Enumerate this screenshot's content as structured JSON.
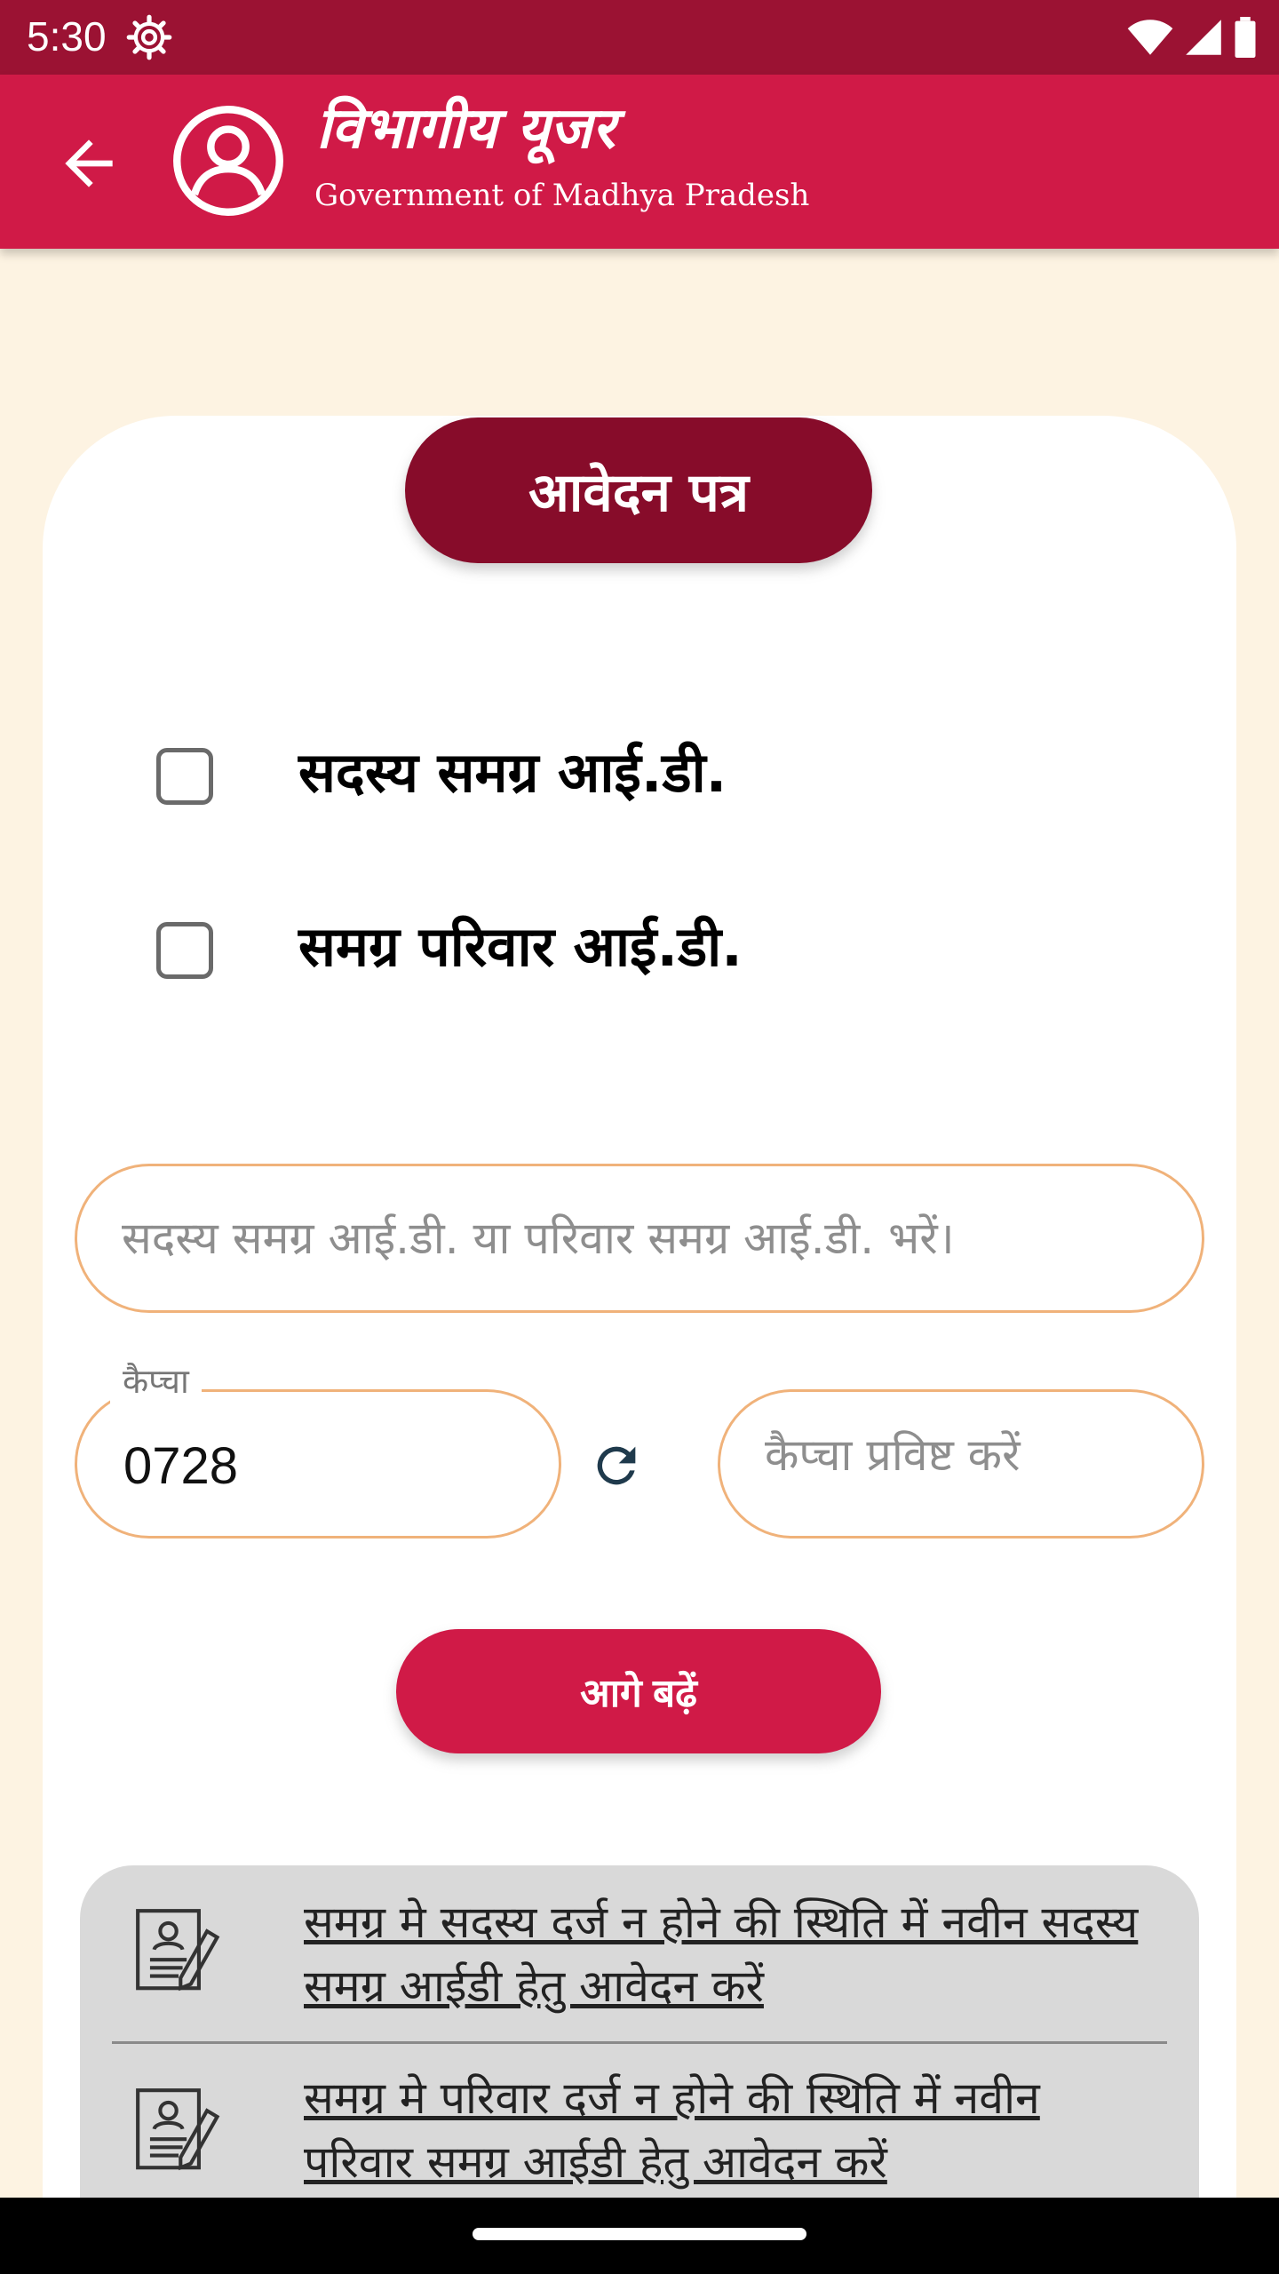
{
  "status_bar": {
    "time": "5:30",
    "icons": [
      "gear-icon",
      "wifi-icon",
      "signal-icon",
      "battery-icon"
    ],
    "background": "#9b1233"
  },
  "app_bar": {
    "title": "विभागीय यूजर",
    "subtitle": "Government of Madhya Pradesh",
    "background": "#d01a47"
  },
  "form": {
    "header": "आवेदन पत्र",
    "options": [
      {
        "label": "सदस्य समग्र आई.डी.",
        "checked": false
      },
      {
        "label": "समग्र परिवार आई.डी.",
        "checked": false
      }
    ],
    "id_input": {
      "placeholder": "सदस्य समग्र आई.डी. या परिवार समग्र आई.डी. भरें।",
      "value": ""
    },
    "captcha": {
      "label": "कैप्चा",
      "value": "0728"
    },
    "captcha_input": {
      "placeholder": "कैप्चा प्रविष्ट करें",
      "value": ""
    },
    "next_button": "आगे बढ़ें"
  },
  "links": [
    {
      "text": "समग्र मे सदस्य दर्ज न होने की स्थिति में नवीन सदस्य समग्र आईडी हेतु आवेदन करें",
      "icon": "application-form-icon"
    },
    {
      "text": "समग्र मे परिवार दर्ज न होने की स्थिति में नवीन परिवार समग्र आईडी हेतु आवेदन करें",
      "icon": "application-form-icon"
    }
  ],
  "colors": {
    "primary": "#d01a47",
    "dark_primary": "#870c2a",
    "page_background": "#fdf3e2",
    "field_border": "#f0b27a",
    "refresh_icon": "#1f3a4c"
  }
}
